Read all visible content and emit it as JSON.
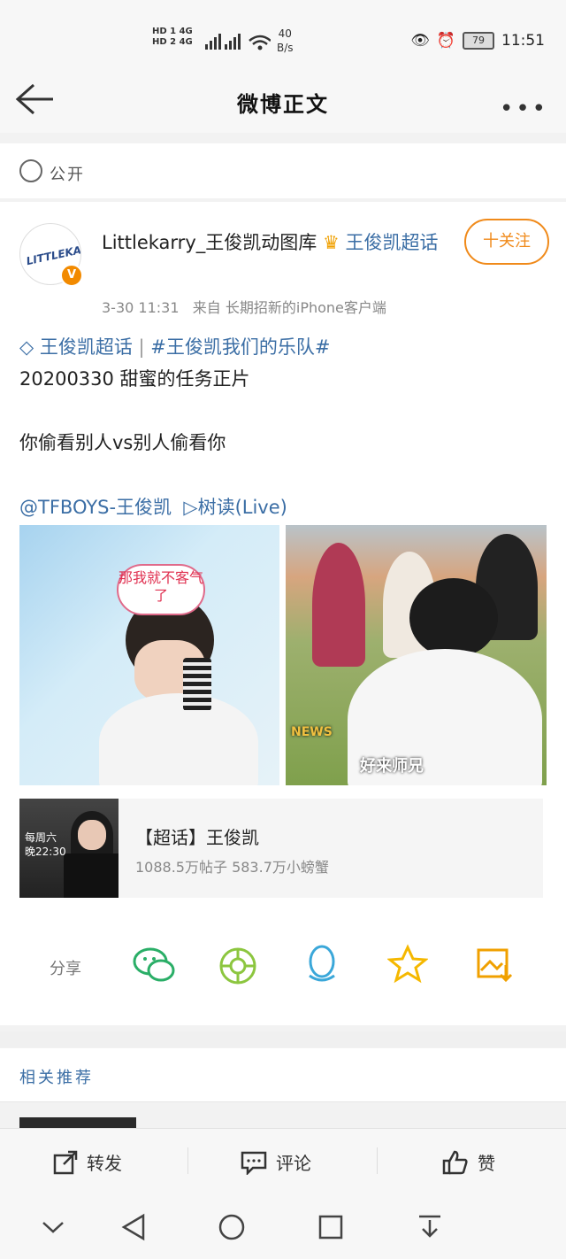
{
  "status_bar": {
    "network_labels": [
      "HD 1 4G",
      "HD 2 4G"
    ],
    "speed_value": "40",
    "speed_unit": "B/s",
    "battery": "79",
    "time": "11:51"
  },
  "header": {
    "title": "微博正文"
  },
  "visibility": {
    "label": "公开"
  },
  "post": {
    "author_name": "Littlekarry_王俊凯动图库",
    "author_topic": "王俊凯超话",
    "avatar_text": "LITTLEKARRY",
    "verified_badge": "V",
    "time": "3-30 11:31",
    "source": "来自 长期招新的iPhone客户端",
    "follow_label": "十关注",
    "topic_tag": "王俊凯超话",
    "hashtag": "#王俊凯我们的乐队#",
    "line1": "20200330 甜蜜的任务正片",
    "line2": "你偷看别人vs别人偷看你",
    "mention": "@TFBOYS-王俊凯",
    "live_label": "▷树读(Live)",
    "image1_caption": "那我就不客气了",
    "image2_caption": "好来师兄",
    "image2_logo": "NEWS"
  },
  "super_topic": {
    "title": "【超话】王俊凯",
    "stats": "1088.5万帖子 583.7万小螃蟹",
    "poster_line1": "每周六",
    "poster_line2": "晚22:30"
  },
  "share": {
    "label": "分享",
    "icons": [
      "wechat-icon",
      "moments-icon",
      "qq-icon",
      "qzone-icon",
      "save-image-icon"
    ]
  },
  "related": {
    "label": "相关推荐"
  },
  "actions": {
    "repost": "转发",
    "comment": "评论",
    "like": "赞"
  },
  "colors": {
    "link": "#3b6ea5",
    "accent": "#f08a1a",
    "wechat": "#2aae67",
    "moments": "#8cc63f",
    "qq": "#3aa7d9",
    "qzone": "#f5b800"
  }
}
